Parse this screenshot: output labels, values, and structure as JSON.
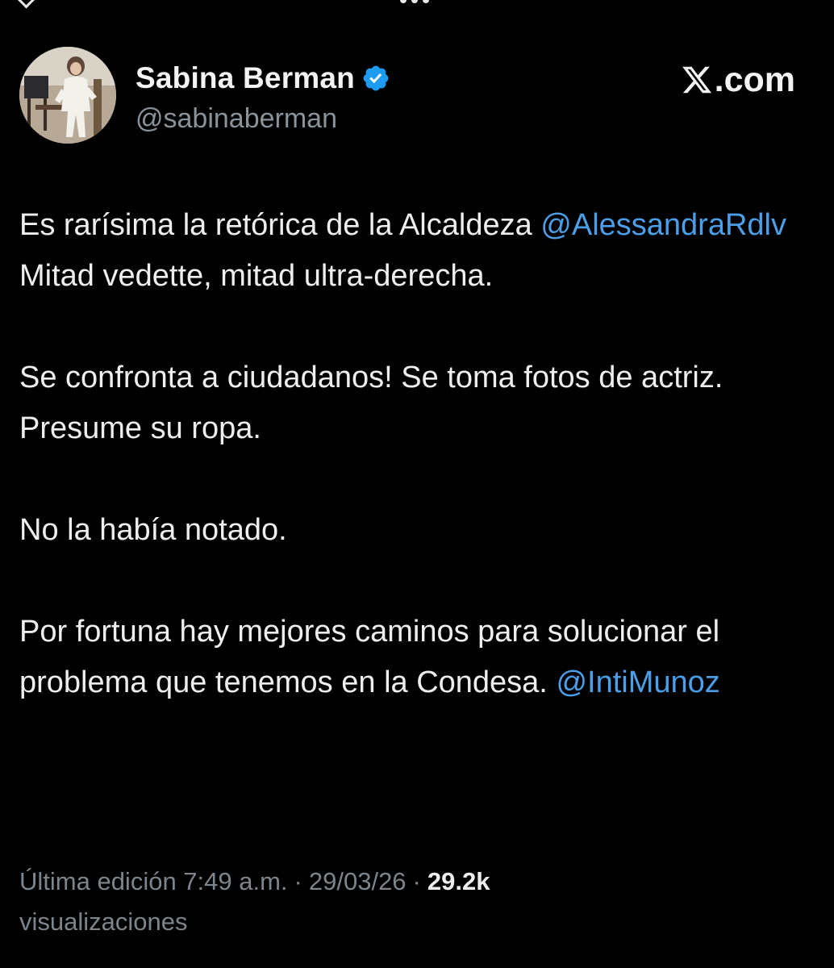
{
  "post": {
    "author": {
      "display_name": "Sabina Berman",
      "handle": "@sabinaberman",
      "verified_icon": "verified-badge-icon",
      "avatar": "profile-photo"
    },
    "brand": {
      "icon": "x-logo-icon",
      "text": ".com"
    },
    "paragraphs": [
      {
        "segments": [
          {
            "text": "Es rarísima la retórica de la Alcaldeza ",
            "type": "text"
          },
          {
            "text": "@AlessandraRdlv",
            "type": "mention"
          },
          {
            "text": " Mitad vedette, mitad ultra-derecha.",
            "type": "text"
          }
        ]
      },
      {
        "segments": [
          {
            "text": "Se confronta a ciudadanos! Se toma fotos de actriz. Presume su ropa.",
            "type": "text"
          }
        ]
      },
      {
        "segments": [
          {
            "text": "No la había notado.",
            "type": "text"
          }
        ]
      },
      {
        "segments": [
          {
            "text": "Por fortuna hay mejores caminos para solucionar el problema que tenemos en la Condesa. ",
            "type": "text"
          },
          {
            "text": "@IntiMunoz",
            "type": "mention"
          }
        ]
      }
    ],
    "meta": {
      "edited_label": "Última edición 7:49 a.m.",
      "separator": "·",
      "date": "29/03/26",
      "views_count": "29.2k",
      "views_label": "visualizaciones"
    },
    "colors": {
      "background": "#000000",
      "text": "#e7e9ea",
      "mention": "#4b9ee8",
      "muted": "#7d858c",
      "verified": "#1d9bf0"
    }
  }
}
